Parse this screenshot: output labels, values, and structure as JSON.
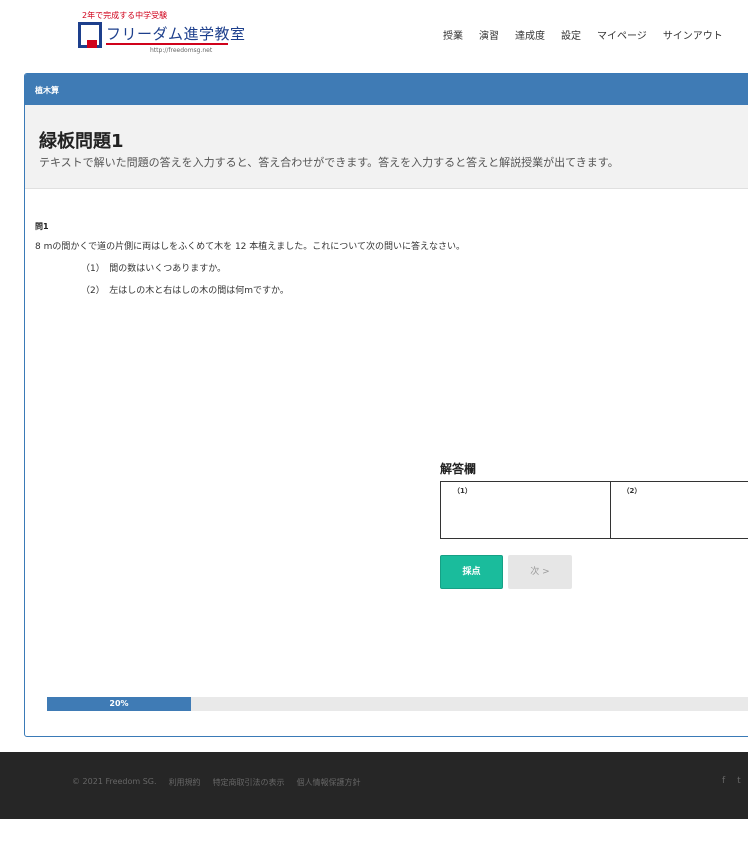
{
  "header": {
    "logo_tagline": "2年で完成する中学受験",
    "logo_name": "フリーダム進学教室",
    "logo_url": "http://freedomsg.net",
    "nav": [
      "授業",
      "演習",
      "達成度",
      "設定",
      "マイページ",
      "サインアウト"
    ]
  },
  "panel": {
    "heading": "植木算",
    "title": "緑板問題1",
    "description": "テキストで解いた問題の答えを入力すると、答え合わせができます。答えを入力すると答えと解説授業が出てきます。"
  },
  "question": {
    "label": "問1",
    "text": "8 mの間かくで道の片側に両はしをふくめて木を 12 本植えました。これについて次の問いに答えなさい。",
    "sub1": "（1）　間の数はいくつありますか。",
    "sub2": "（2）　左はしの木と右はしの木の間は何mですか。"
  },
  "answer": {
    "title": "解答欄",
    "cell1": "（1）",
    "cell2": "（2）"
  },
  "buttons": {
    "grade": "採点",
    "next": "次 >"
  },
  "progress": {
    "percent": 20,
    "label": "20%"
  },
  "footer": {
    "copyright": "© 2021 Freedom SG.",
    "links": [
      "利用規約",
      "特定商取引法の表示",
      "個人情報保護方針"
    ],
    "social": [
      "f",
      "t"
    ]
  },
  "colors": {
    "primary": "#3f7bb5",
    "accent": "#1abc9c",
    "footer_bg": "#262626"
  }
}
